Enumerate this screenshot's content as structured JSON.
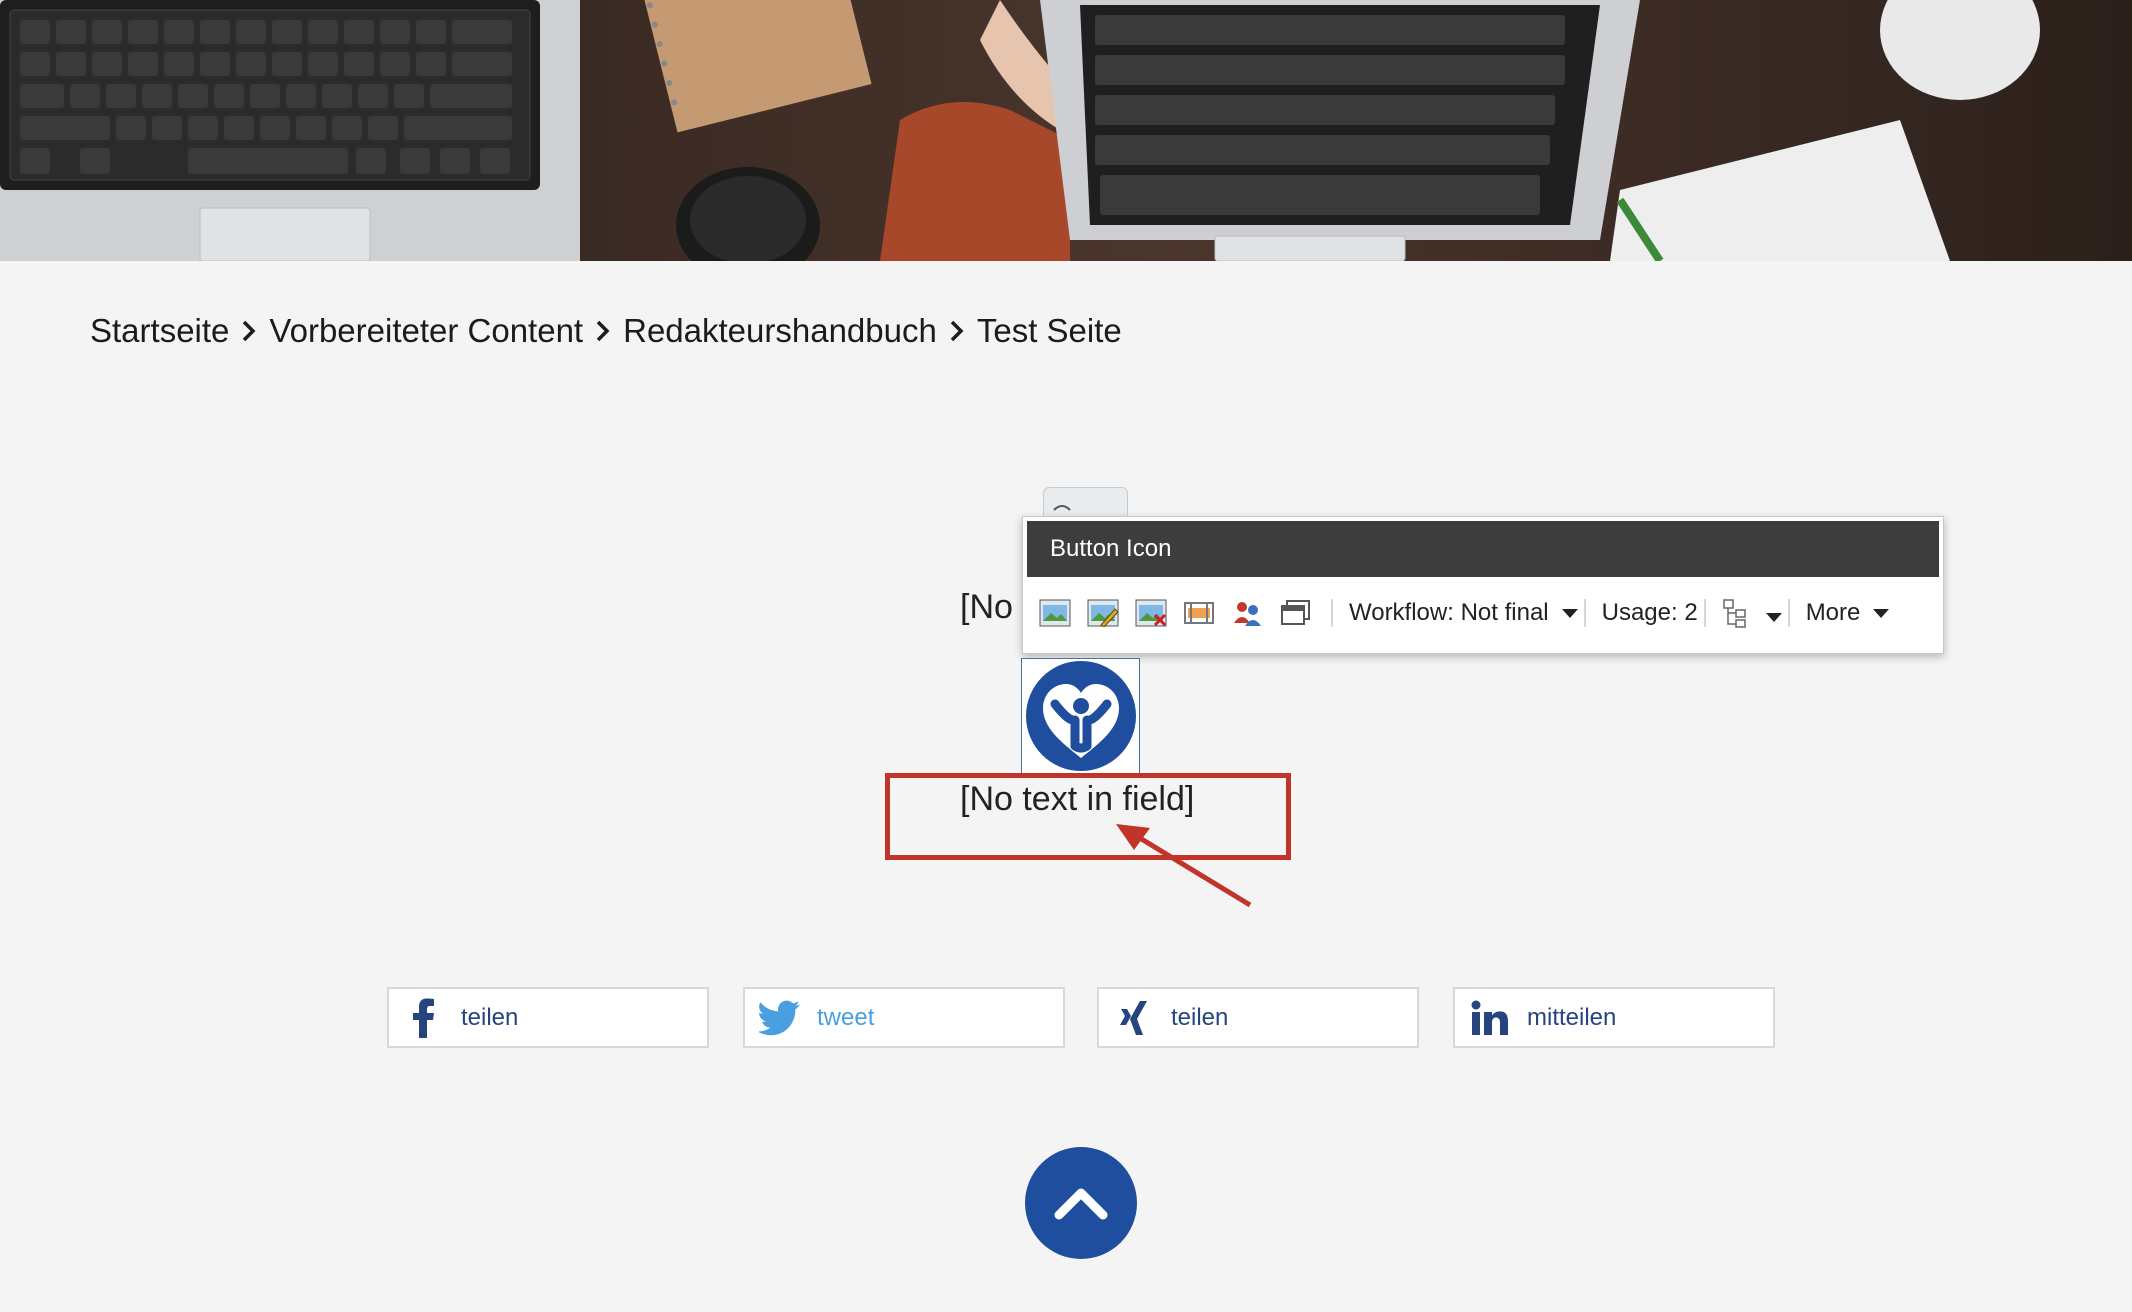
{
  "breadcrumb": {
    "items": [
      {
        "label": "Startseite"
      },
      {
        "label": "Vorbereiteter Content"
      },
      {
        "label": "Redakteurshandbuch"
      },
      {
        "label": "Test Seite"
      }
    ]
  },
  "editor_popup": {
    "title": "Button Icon",
    "tools": [
      "insert-image-icon",
      "edit-image-icon",
      "remove-image-icon",
      "image-properties-icon",
      "users-icon",
      "window-icon"
    ],
    "workflow_label": "Workflow: Not final",
    "usage_label": "Usage: 2",
    "more_label": "More"
  },
  "content": {
    "field_placeholder_top": "[No",
    "field_placeholder": "[No text in field]"
  },
  "share": {
    "facebook_label": "teilen",
    "twitter_label": "tweet",
    "xing_label": "teilen",
    "linkedin_label": "mitteilen"
  },
  "colors": {
    "accent_blue": "#1e4e9d",
    "highlight_red": "#c0342a",
    "twitter_blue": "#4a9fe0"
  }
}
